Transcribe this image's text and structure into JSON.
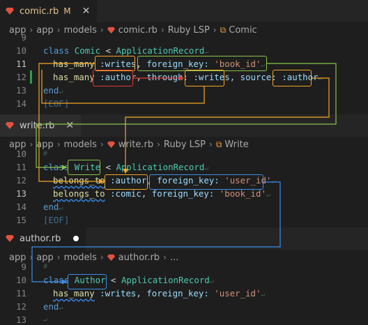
{
  "editor1": {
    "tab": {
      "name": "comic.rb",
      "modified": "M"
    },
    "breadcrumb": [
      "app",
      "app",
      "models",
      "comic.rb",
      "Ruby LSP",
      "Comic"
    ],
    "lines": [
      {
        "n": "9",
        "text": "#"
      },
      {
        "n": "10",
        "text": "class Comic < ApplicationRecord"
      },
      {
        "n": "11",
        "text": "has_many :writes, foreign_key: 'book_id'"
      },
      {
        "n": "12",
        "text": "has_many :author, through: :writes, source: :author"
      },
      {
        "n": "13",
        "text": "end"
      },
      {
        "n": "14",
        "text": "[EOF]"
      }
    ]
  },
  "editor2": {
    "tab": {
      "name": "write.rb"
    },
    "breadcrumb": [
      "app",
      "app",
      "models",
      "write.rb",
      "Ruby LSP",
      "Write"
    ],
    "lines": [
      {
        "n": "10",
        "text": "#"
      },
      {
        "n": "11",
        "text": "class Write < ApplicationRecord"
      },
      {
        "n": "12",
        "text": "belongs_to :author, foreign_key: 'user_id'"
      },
      {
        "n": "13",
        "text": "belongs_to :comic, foreign_key: 'book_id'"
      },
      {
        "n": "14",
        "text": "end"
      },
      {
        "n": "15",
        "text": "[EOF]"
      }
    ]
  },
  "editor3": {
    "tab": {
      "name": "author.rb"
    },
    "breadcrumb": [
      "app",
      "app",
      "models",
      "author.rb",
      "..."
    ],
    "lines": [
      {
        "n": "9",
        "text": "#"
      },
      {
        "n": "10",
        "text": "class Author < ApplicationRecord"
      },
      {
        "n": "11",
        "text": "has_many :writes, foreign_key: 'user_id'"
      },
      {
        "n": "12",
        "text": "end"
      },
      {
        "n": "13",
        "text": "#"
      }
    ]
  },
  "colors": {
    "orange": "#f5a623",
    "green": "#8bc34a",
    "red": "#e53935",
    "blue": "#3a8ee6",
    "ruby": "#e0533f"
  }
}
